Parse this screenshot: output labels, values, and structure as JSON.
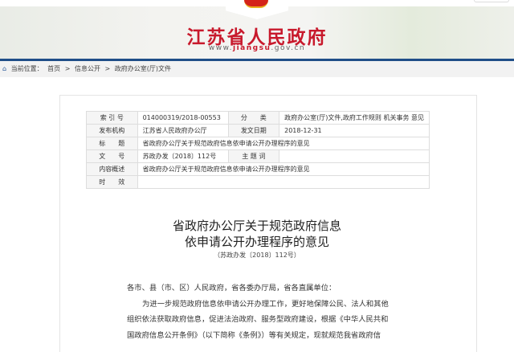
{
  "header": {
    "site_title": "江苏省人民政府",
    "url_prefix": "www.",
    "url_brand": "jiangsu",
    "url_suffix": ".gov.cn",
    "accent": "#c8192c"
  },
  "breadcrumb": {
    "label": "当前位置：",
    "items": [
      "首页",
      ">",
      "信息公开",
      ">",
      "政府办公室(厅)文件"
    ]
  },
  "meta": {
    "index_label": "索 引 号",
    "index_value": "014000319/2018-00553",
    "category_label": "分　　类",
    "category_value": "政府办公室(厅)文件,政府工作规则 机关事务 意见",
    "publisher_label": "发布机构",
    "publisher_value": "江苏省人民政府办公厅",
    "date_label": "发文日期",
    "date_value": "2018-12-31",
    "title_label": "标　　题",
    "title_value": "省政府办公厅关于规范政府信息依申请公开办理程序的意见",
    "docno_label": "文　　号",
    "docno_value": "苏政办发〔2018〕112号",
    "keyword_label": "主 题 词",
    "keyword_value": "",
    "summary_label": "内容概述",
    "summary_value": "省政府办公厅关于规范政府信息依申请公开办理程序的意见",
    "validity_label": "时　　效",
    "validity_value": ""
  },
  "article": {
    "title_line1": "省政府办公厅关于规范政府信息",
    "title_line2": "依申请公开办理程序的意见",
    "doc_number": "（苏政办发〔2018〕112号）",
    "paragraphs": [
      "各市、县（市、区）人民政府，省各委办厅局，省各直属单位：",
      "为进一步规范政府信息依申请公开办理工作，更好地保障公民、法人和其他",
      "组织依法获取政府信息，促进法治政府、服务型政府建设，根据《中华人民共和",
      "国政府信息公开条例》（以下简称《条例》）等有关规定，现就规范我省政府信"
    ]
  }
}
